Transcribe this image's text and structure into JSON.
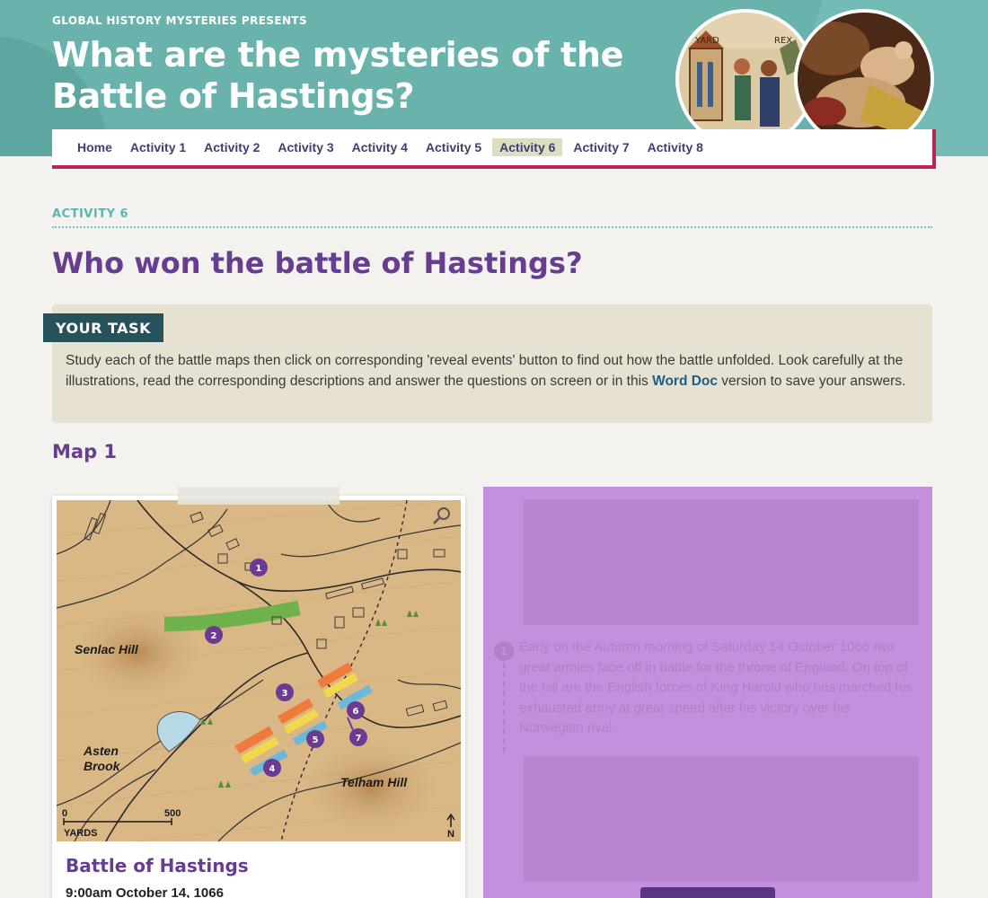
{
  "header": {
    "presents": "GLOBAL HISTORY MYSTERIES PRESENTS",
    "title": "What are the mysteries of the Battle of Hastings?",
    "tapestry_words": [
      "YARD",
      "REX"
    ]
  },
  "nav": {
    "items": [
      "Home",
      "Activity 1",
      "Activity 2",
      "Activity 3",
      "Activity 4",
      "Activity 5",
      "Activity 6",
      "Activity 7",
      "Activity 8"
    ],
    "active": "Activity 6"
  },
  "activity": {
    "label": "ACTIVITY 6",
    "title": "Who won the battle of Hastings?"
  },
  "task": {
    "tag": "YOUR TASK",
    "text_before": "Study each of the battle maps then click on corresponding 'reveal events' button to find out how the battle unfolded. Look carefully at the illustrations, read the corresponding descriptions and answer the questions on screen or in this ",
    "link": "Word Doc",
    "text_after": " version to save your answers."
  },
  "map_section": {
    "heading": "Map 1",
    "card_title": "Battle of Hastings",
    "card_time": "9:00am October 14, 1066",
    "labels": {
      "senlac": "Senlac Hill",
      "asten_1": "Asten",
      "asten_2": "Brook",
      "telham": "Telham Hill",
      "scale_start": "0",
      "scale_end": "500",
      "scale_unit": "YARDS",
      "north": "N"
    },
    "markers": [
      "1",
      "2",
      "3",
      "4",
      "5",
      "6",
      "7"
    ]
  },
  "events": {
    "number": "1",
    "text": "Early on the Autumn morning of Saturday 14 October 1066 two great armies face off in battle for the throne of England. On top of the hill are the English forces of King Harold who has marched his exhausted army at great speed after his victory over his Norwegian rival."
  },
  "colors": {
    "header_bg": "#6ab3ad",
    "purple": "#663d8f",
    "teal_label": "#5ab5b7",
    "task_tag": "#26525b",
    "nav_border": "#b8245a",
    "overlay": "#c48fdd"
  }
}
